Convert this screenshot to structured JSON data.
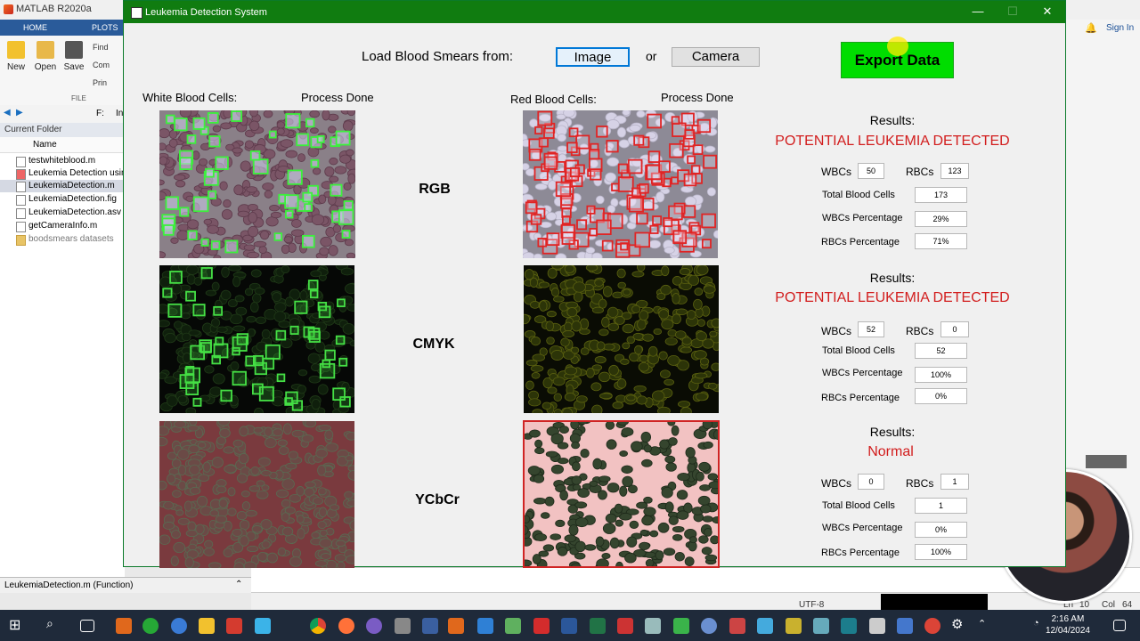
{
  "matlab": {
    "title": "MATLAB R2020a",
    "tabs": [
      "HOME",
      "PLOTS"
    ],
    "ribbon": {
      "new": "New",
      "open": "Open",
      "save": "Save",
      "find": "Find",
      "compare": "Com",
      "print": "Prin",
      "group": "FILE"
    },
    "path_crumb": "F:",
    "path_crumb2": "In",
    "current_folder": "Current Folder",
    "name_col": "Name",
    "files": [
      "testwhiteblood.m",
      "Leukemia Detection usin",
      "LeukemiaDetection.m",
      "LeukemiaDetection.fig",
      "LeukemiaDetection.asv",
      "getCameraInfo.m",
      "boodsmears datasets"
    ],
    "function_bar": "LeukemiaDetection.m (Function)",
    "sign_in": "Sign In",
    "status": {
      "encoding": "UTF-8",
      "ln_label": "Ln",
      "ln": "10",
      "col_label": "Col",
      "col": "64"
    }
  },
  "taskbar": {
    "time": "2:16 AM",
    "date": "12/04/2024"
  },
  "app": {
    "title": "Leukemia Detection System",
    "load_label": "Load Blood Smears from:",
    "image_btn": "Image",
    "or_label": "or",
    "camera_btn": "Camera",
    "export_btn": "Export Data",
    "wbc_header": "White Blood Cells:",
    "wbc_status": "Process Done",
    "rbc_header": "Red Blood Cells:",
    "rbc_status": "Process Done",
    "spaces": [
      "RGB",
      "CMYK",
      "YCbCr"
    ],
    "results": [
      {
        "title": "Results:",
        "status": "POTENTIAL LEUKEMIA DETECTED",
        "wbcs": "50",
        "rbcs": "123",
        "total": "173",
        "wbc_pct": "29%",
        "rbc_pct": "71%"
      },
      {
        "title": "Results:",
        "status": "POTENTIAL LEUKEMIA DETECTED",
        "wbcs": "52",
        "rbcs": "0",
        "total": "52",
        "wbc_pct": "100%",
        "rbc_pct": "0%"
      },
      {
        "title": "Results:",
        "status": "Normal",
        "wbcs": "0",
        "rbcs": "1",
        "total": "1",
        "wbc_pct": "0%",
        "rbc_pct": "100%"
      }
    ],
    "field_labels": {
      "wbcs": "WBCs",
      "rbcs": "RBCs",
      "total": "Total Blood Cells",
      "wbc_pct": "WBCs Percentage",
      "rbc_pct": "RBCs Percentage"
    }
  }
}
